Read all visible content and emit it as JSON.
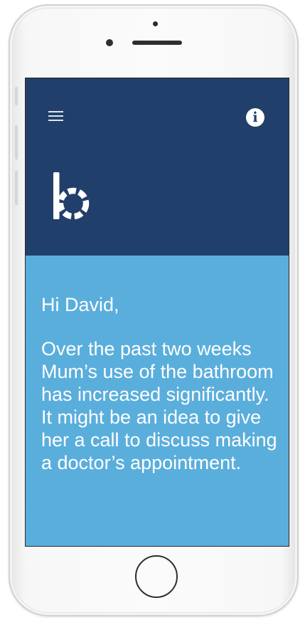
{
  "device": {
    "frame_color": "#f7f7f7"
  },
  "app": {
    "header_color": "#213f6b",
    "background_color": "#5aaedc",
    "menu_icon": "hamburger-menu-icon",
    "info_icon": "info-icon",
    "info_glyph": "i",
    "logo": "b-logo"
  },
  "message": {
    "greeting": "Hi David,",
    "body": "Over the past two weeks Mum’s use of the bathroom has increased significantly. It might be an idea to give her a call to discuss making a doctor’s appointment."
  }
}
